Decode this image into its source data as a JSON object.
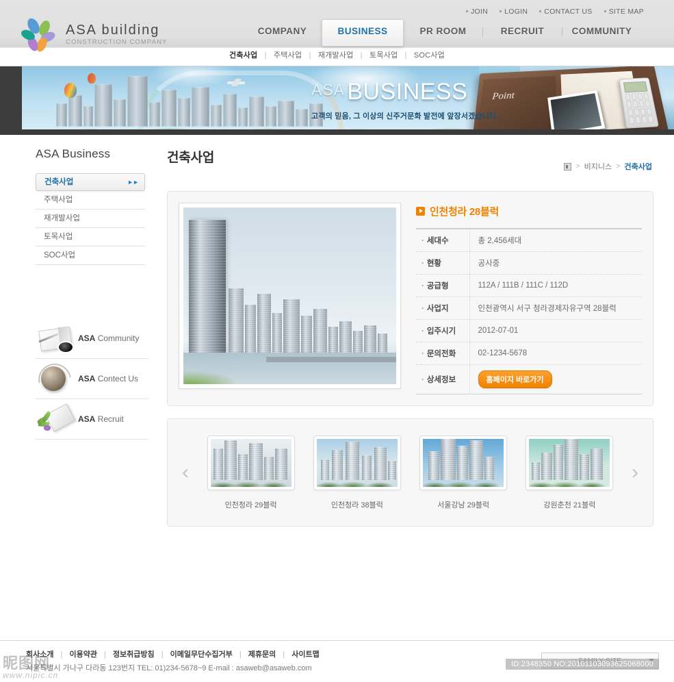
{
  "site": {
    "logo_title": "ASA building",
    "logo_subtitle": "CONSTRUCTION COMPANY",
    "logo_petal_colors": [
      "#5b9bd5",
      "#8cc152",
      "#a59ad8",
      "#f0a33c",
      "#b07fcf",
      "#19a192"
    ],
    "accent_blue": "#1d6fa9",
    "accent_orange": "#ef8200"
  },
  "utility_nav": [
    {
      "label": "JOIN"
    },
    {
      "label": "LOGIN"
    },
    {
      "label": "CONTACT US"
    },
    {
      "label": "SITE MAP"
    }
  ],
  "main_nav": [
    {
      "label": "COMPANY",
      "active": false
    },
    {
      "label": "BUSINESS",
      "active": true
    },
    {
      "label": "PR ROOM",
      "active": false
    },
    {
      "label": "RECRUIT",
      "active": false
    },
    {
      "label": "COMMUNITY",
      "active": false
    }
  ],
  "sub_nav": [
    {
      "label": "건축사업",
      "active": true
    },
    {
      "label": "주택사업",
      "active": false
    },
    {
      "label": "재개발사업",
      "active": false
    },
    {
      "label": "토목사업",
      "active": false
    },
    {
      "label": "SOC사업",
      "active": false
    }
  ],
  "banner": {
    "eyebrow": "ASA",
    "title": "BUSINESS",
    "tagline": "고객의 믿음, 그 이상의 신주거문화 발전에 앞장서겠습니다.",
    "book_label": "Point"
  },
  "sidebar": {
    "title": "ASA Business",
    "items": [
      {
        "label": "건축사업",
        "active": true
      },
      {
        "label": "주택사업",
        "active": false
      },
      {
        "label": "재개발사업",
        "active": false
      },
      {
        "label": "토목사업",
        "active": false
      },
      {
        "label": "SOC사업",
        "active": false
      }
    ],
    "banners": [
      {
        "brand": "ASA",
        "label": "Community",
        "icon": "notebook-pen-icon"
      },
      {
        "brand": "ASA",
        "label": "Contect Us",
        "icon": "globe-icon"
      },
      {
        "brand": "ASA",
        "label": "Recruit",
        "icon": "plant-book-icon"
      }
    ]
  },
  "main": {
    "page_title": "건축사업",
    "breadcrumb": {
      "home_icon": "home-icon",
      "items": [
        "비지니스",
        "건축사업"
      ]
    },
    "project": {
      "title": "인천청라 28블럭",
      "specs": [
        {
          "label": "세대수",
          "value": "총 2,456세대"
        },
        {
          "label": "현황",
          "value": "공사중"
        },
        {
          "label": "공급형",
          "value": "112A / 111B / 111C / 112D"
        },
        {
          "label": "사업지",
          "value": "인천광역시 서구 청라경제자유구역 28블럭"
        },
        {
          "label": "입주시기",
          "value": "2012-07-01"
        },
        {
          "label": "문의전화",
          "value": "02-1234-5678"
        }
      ],
      "detail_label": "상세정보",
      "detail_button": "홈페이지 바로가기"
    },
    "gallery": {
      "prev_icon": "chevron-left-icon",
      "next_icon": "chevron-right-icon",
      "thumbs": [
        {
          "caption": "인천청라 29블럭"
        },
        {
          "caption": "인천청라 38블럭"
        },
        {
          "caption": "서울강남 29블럭"
        },
        {
          "caption": "강원춘천 21블럭"
        }
      ]
    }
  },
  "footer": {
    "links": [
      "회사소개",
      "이용약관",
      "정보취급방침",
      "이메일무단수집거부",
      "제휴문의",
      "사이트맵"
    ],
    "address": "서울특별시 가나구 다라동 123번지  TEL: 01)234-5678~9   E-mail : asaweb@asaweb.com",
    "family_site": "::: FAMILY SITE :::",
    "id_overlay": "ID:2348350 NO:20101103093625068000",
    "watermark": "昵图网",
    "watermark_sub": "www.nipic.cn"
  }
}
